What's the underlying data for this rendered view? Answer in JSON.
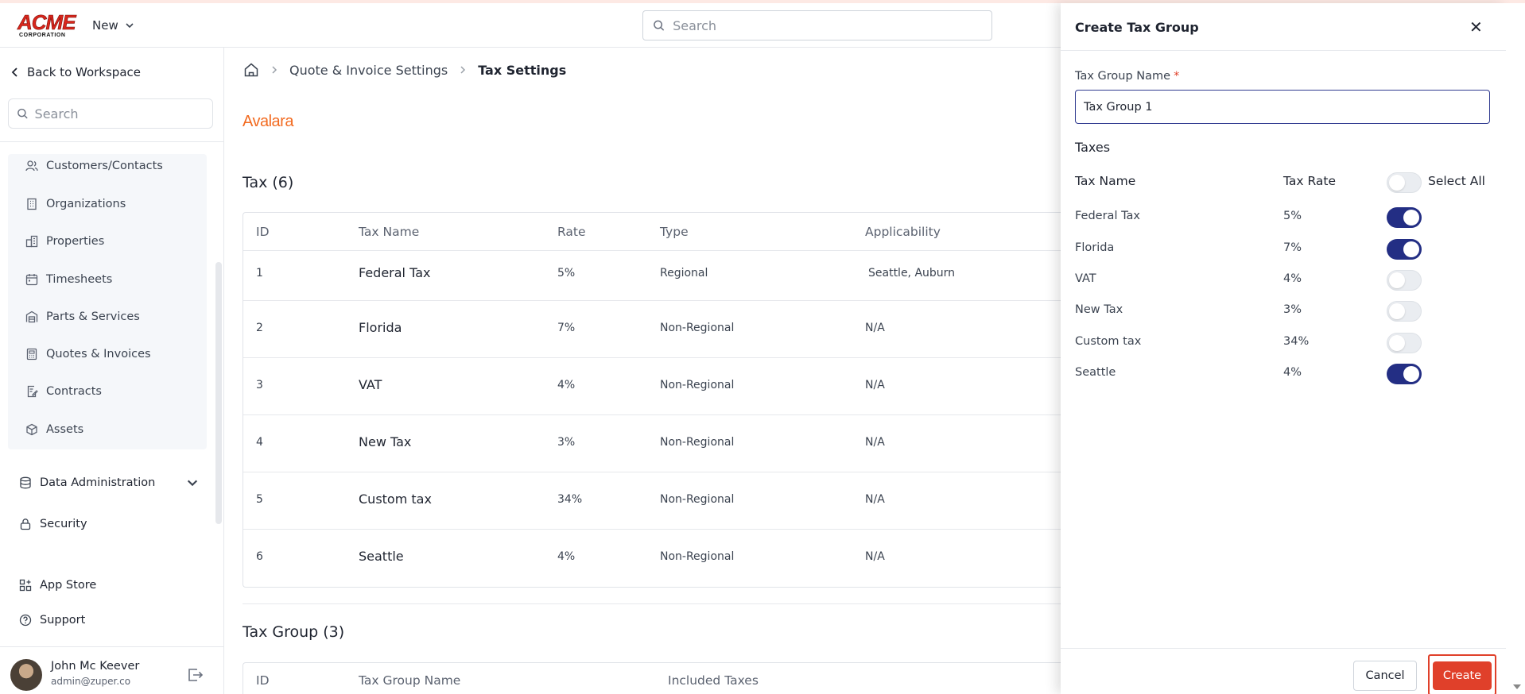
{
  "header": {
    "logo_main": "ACME",
    "logo_sub": "CORPORATION",
    "new_label": "New",
    "search_placeholder": "Search"
  },
  "sidebar": {
    "back_label": "Back to Workspace",
    "search_placeholder": "Search",
    "sub_items": [
      {
        "label": "Customers/Contacts",
        "icon": "contacts-icon"
      },
      {
        "label": "Organizations",
        "icon": "building-icon"
      },
      {
        "label": "Properties",
        "icon": "properties-icon"
      },
      {
        "label": "Timesheets",
        "icon": "calendar-icon"
      },
      {
        "label": "Parts & Services",
        "icon": "warehouse-icon"
      },
      {
        "label": "Quotes & Invoices",
        "icon": "invoice-icon"
      },
      {
        "label": "Contracts",
        "icon": "contract-icon"
      },
      {
        "label": "Assets",
        "icon": "cube-icon"
      }
    ],
    "data_admin_label": "Data Administration",
    "security_label": "Security",
    "app_store_label": "App Store",
    "support_label": "Support",
    "user": {
      "name": "John Mc Keever",
      "email": "admin@zuper.co"
    }
  },
  "breadcrumb": {
    "parent": "Quote & Invoice Settings",
    "current": "Tax Settings"
  },
  "brand": "Avalara",
  "tax_section": {
    "title": "Tax (6)",
    "columns": [
      "ID",
      "Tax Name",
      "Rate",
      "Type",
      "Applicability"
    ],
    "rows": [
      {
        "id": "1",
        "name": "Federal Tax",
        "rate": "5%",
        "type": "Regional",
        "applicability": "Seattle, Auburn"
      },
      {
        "id": "2",
        "name": "Florida",
        "rate": "7%",
        "type": "Non-Regional",
        "applicability": "N/A"
      },
      {
        "id": "3",
        "name": "VAT",
        "rate": "4%",
        "type": "Non-Regional",
        "applicability": "N/A"
      },
      {
        "id": "4",
        "name": "New Tax",
        "rate": "3%",
        "type": "Non-Regional",
        "applicability": "N/A"
      },
      {
        "id": "5",
        "name": "Custom tax",
        "rate": "34%",
        "type": "Non-Regional",
        "applicability": "N/A"
      },
      {
        "id": "6",
        "name": "Seattle",
        "rate": "4%",
        "type": "Non-Regional",
        "applicability": "N/A"
      }
    ]
  },
  "tax_group_section": {
    "title": "Tax Group (3)",
    "columns": [
      "ID",
      "Tax Group Name",
      "Included Taxes"
    ]
  },
  "drawer": {
    "title": "Create Tax Group",
    "name_label": "Tax Group Name",
    "required_mark": "*",
    "name_value": "Tax Group 1",
    "taxes_label": "Taxes",
    "col_name": "Tax Name",
    "col_rate": "Tax Rate",
    "select_all_label": "Select All",
    "select_all_on": false,
    "taxes": [
      {
        "name": "Federal Tax",
        "rate": "5%",
        "selected": true
      },
      {
        "name": "Florida",
        "rate": "7%",
        "selected": true
      },
      {
        "name": "VAT",
        "rate": "4%",
        "selected": false
      },
      {
        "name": "New Tax",
        "rate": "3%",
        "selected": false
      },
      {
        "name": "Custom tax",
        "rate": "34%",
        "selected": false
      },
      {
        "name": "Seattle",
        "rate": "4%",
        "selected": true
      }
    ],
    "cancel_label": "Cancel",
    "create_label": "Create"
  }
}
